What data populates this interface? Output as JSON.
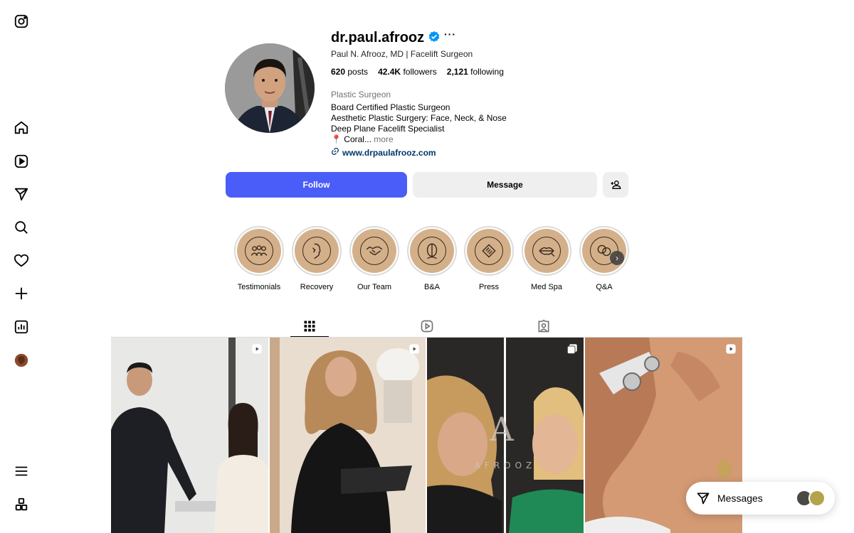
{
  "sidebar": {
    "icons": [
      "instagram-logo-icon",
      "home-icon",
      "reels-icon",
      "explore-icon",
      "search-icon",
      "heart-icon",
      "plus-icon",
      "insights-icon",
      "profile-avatar-icon",
      "menu-icon",
      "more-apps-icon"
    ]
  },
  "profile": {
    "username": "dr.paul.afrooz",
    "full_name": "Paul N. Afrooz, MD | Facelift Surgeon",
    "posts_count": "620",
    "posts_label": "posts",
    "followers_count": "42.4K",
    "followers_label": "followers",
    "following_count": "2,121",
    "following_label": "following",
    "category": "Plastic Surgeon",
    "bio_lines": [
      "Board Certified Plastic Surgeon",
      "Aesthetic Plastic Surgery: Face, Neck, & Nose",
      "Deep Plane Facelift Specialist"
    ],
    "bio_location": "📍 Coral...",
    "bio_more": "more",
    "website": "www.drpaulafrooz.com"
  },
  "actions": {
    "follow_label": "Follow",
    "message_label": "Message"
  },
  "highlights": [
    {
      "label": "Testimonials"
    },
    {
      "label": "Recovery"
    },
    {
      "label": "Our Team"
    },
    {
      "label": "B&A"
    },
    {
      "label": "Press"
    },
    {
      "label": "Med Spa"
    },
    {
      "label": "Q&A"
    }
  ],
  "tabs": [
    "posts-grid",
    "reels",
    "tagged"
  ],
  "posts": [
    {
      "type": "reel"
    },
    {
      "type": "reel"
    },
    {
      "type": "carousel",
      "watermark": "AFROOZ"
    },
    {
      "type": "reel"
    }
  ],
  "messages_widget": {
    "label": "Messages"
  },
  "colors": {
    "follow_button": "#4a5df9",
    "highlight_fill": "#d4b08a",
    "link": "#00376b",
    "verified": "#0095f6"
  }
}
